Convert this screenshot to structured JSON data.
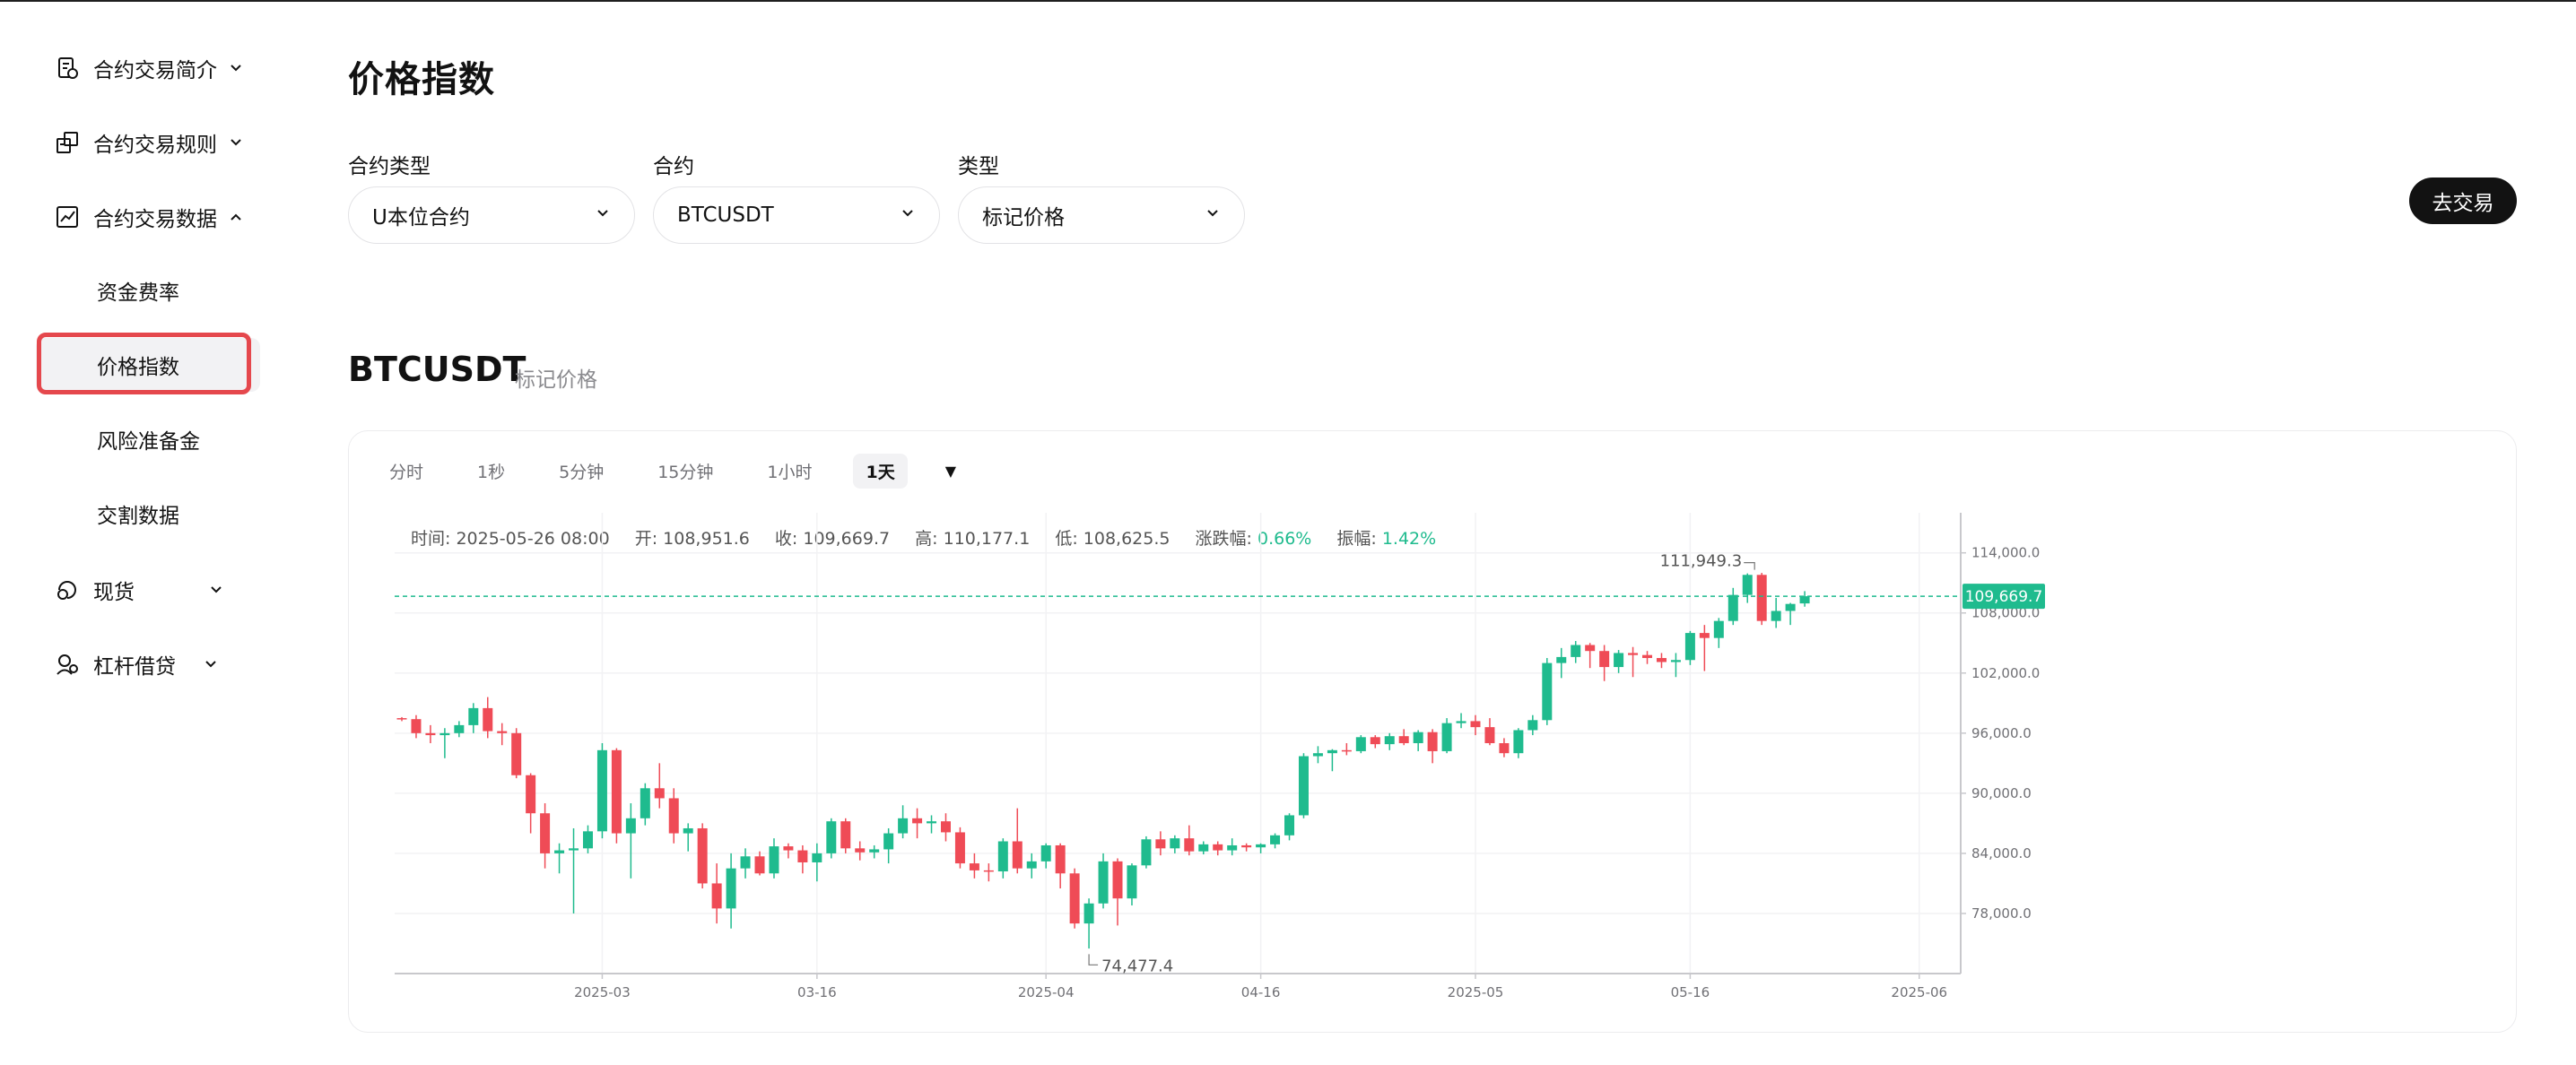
{
  "sidebar": {
    "items": [
      {
        "label": "合约交易简介",
        "icon": "document-icon",
        "expanded": false
      },
      {
        "label": "合约交易规则",
        "icon": "rules-icon",
        "expanded": false
      },
      {
        "label": "合约交易数据",
        "icon": "chart-data-icon",
        "expanded": true
      },
      {
        "label": "现货",
        "icon": "spot-icon",
        "expanded": false
      },
      {
        "label": "杠杆借贷",
        "icon": "margin-icon",
        "expanded": false
      }
    ],
    "sub_items": [
      "资金费率",
      "价格指数",
      "风险准备金",
      "交割数据"
    ],
    "active_sub": "价格指数"
  },
  "main": {
    "title": "价格指数",
    "filters": [
      {
        "label": "合约类型",
        "value": "U本位合约"
      },
      {
        "label": "合约",
        "value": "BTCUSDT"
      },
      {
        "label": "类型",
        "value": "标记价格"
      }
    ],
    "trade_button": "去交易",
    "symbol": "BTCUSDT",
    "symbol_sub": "标记价格"
  },
  "chart_toolbar": {
    "intervals": [
      "分时",
      "1秒",
      "5分钟",
      "15分钟",
      "1小时",
      "1天"
    ],
    "active": "1天",
    "more_icon": "caret-down-icon"
  },
  "ohlc_info": {
    "time_label": "时间:",
    "time": "2025-05-26 08:00",
    "open_label": "开:",
    "open": "108,951.6",
    "close_label": "收:",
    "close": "109,669.7",
    "high_label": "高:",
    "high": "110,177.1",
    "low_label": "低:",
    "low": "108,625.5",
    "change_label": "涨跌幅:",
    "change": "0.66%",
    "amplitude_label": "振幅:",
    "amplitude": "1.42%"
  },
  "colors": {
    "up": "#1fbb8e",
    "down": "#ef4b56",
    "highlight": "#e5484d"
  },
  "chart_data": {
    "type": "candlestick",
    "y_ticks": [
      "114,000.0",
      "108,000.0",
      "102,000.0",
      "96,000.0",
      "90,000.0",
      "84,000.0",
      "78,000.0"
    ],
    "ylim": [
      72000,
      118000
    ],
    "x_ticks": [
      "2025-03",
      "03-16",
      "2025-04",
      "04-16",
      "2025-05",
      "05-16",
      "2025-06"
    ],
    "start_date": "2025-02-15",
    "current_price": 109669.7,
    "current_price_label": "109,669.7",
    "max_label": "111,949.3",
    "min_label": "74,477.4",
    "max_value": 111949.3,
    "min_value": 74477.4,
    "candles": [
      [
        97500,
        97600,
        97200,
        97400
      ],
      [
        97400,
        97800,
        95500,
        96000
      ],
      [
        96000,
        96800,
        95000,
        95800
      ],
      [
        95800,
        96500,
        93500,
        96000
      ],
      [
        96000,
        97200,
        95600,
        96800
      ],
      [
        96800,
        99000,
        96000,
        98500
      ],
      [
        98500,
        99600,
        95500,
        96200
      ],
      [
        96200,
        97000,
        94800,
        96000
      ],
      [
        96000,
        96500,
        91500,
        91800
      ],
      [
        91800,
        92000,
        86000,
        88000
      ],
      [
        88000,
        89000,
        82500,
        84000
      ],
      [
        84000,
        85000,
        82000,
        84300
      ],
      [
        84300,
        86500,
        78000,
        84500
      ],
      [
        84500,
        86800,
        84000,
        86200
      ],
      [
        86200,
        95000,
        85500,
        94300
      ],
      [
        94300,
        94500,
        85000,
        86000
      ],
      [
        86000,
        89000,
        81500,
        87500
      ],
      [
        87500,
        91000,
        86800,
        90500
      ],
      [
        90500,
        93000,
        88500,
        89500
      ],
      [
        89500,
        90500,
        85000,
        86000
      ],
      [
        86000,
        87000,
        84200,
        86500
      ],
      [
        86500,
        87000,
        80500,
        81000
      ],
      [
        81000,
        83000,
        77000,
        78500
      ],
      [
        78500,
        84000,
        76500,
        82500
      ],
      [
        82500,
        84500,
        81500,
        83700
      ],
      [
        83700,
        84200,
        81800,
        82000
      ],
      [
        82000,
        85500,
        81500,
        84700
      ],
      [
        84700,
        85000,
        83500,
        84300
      ],
      [
        84300,
        84800,
        82000,
        83100
      ],
      [
        83100,
        85000,
        81200,
        84000
      ],
      [
        84000,
        87500,
        83500,
        87200
      ],
      [
        87200,
        87500,
        84000,
        84500
      ],
      [
        84500,
        85200,
        83300,
        84100
      ],
      [
        84100,
        84800,
        83500,
        84400
      ],
      [
        84400,
        86500,
        83000,
        86000
      ],
      [
        86000,
        88800,
        85500,
        87500
      ],
      [
        87500,
        88500,
        85500,
        87000
      ],
      [
        87000,
        87800,
        86000,
        87200
      ],
      [
        87200,
        88000,
        85200,
        86100
      ],
      [
        86100,
        86600,
        82500,
        83000
      ],
      [
        83000,
        84000,
        81500,
        82300
      ],
      [
        82300,
        83000,
        81200,
        82200
      ],
      [
        82200,
        85500,
        81500,
        85200
      ],
      [
        85200,
        88500,
        82000,
        82500
      ],
      [
        82500,
        84000,
        81500,
        83200
      ],
      [
        83200,
        85000,
        82500,
        84800
      ],
      [
        84800,
        85000,
        80500,
        82000
      ],
      [
        82000,
        82500,
        76500,
        77000
      ],
      [
        77000,
        79500,
        74500,
        79000
      ],
      [
        79000,
        84000,
        78500,
        83200
      ],
      [
        83200,
        83500,
        76800,
        79500
      ],
      [
        79500,
        83000,
        78800,
        82800
      ],
      [
        82800,
        85700,
        82500,
        85400
      ],
      [
        85400,
        86200,
        83800,
        84500
      ],
      [
        84500,
        85800,
        84000,
        85500
      ],
      [
        85500,
        86800,
        83800,
        84200
      ],
      [
        84200,
        85200,
        83900,
        84900
      ],
      [
        84900,
        85200,
        83800,
        84300
      ],
      [
        84300,
        85500,
        83800,
        84800
      ],
      [
        84800,
        85000,
        84200,
        84600
      ],
      [
        84600,
        85000,
        84000,
        84900
      ],
      [
        84900,
        86000,
        84500,
        85800
      ],
      [
        85800,
        88000,
        85300,
        87800
      ],
      [
        87800,
        94000,
        87500,
        93700
      ],
      [
        93700,
        94700,
        93000,
        94000
      ],
      [
        94000,
        94400,
        92200,
        94300
      ],
      [
        94300,
        95000,
        93800,
        94200
      ],
      [
        94200,
        95800,
        94000,
        95600
      ],
      [
        95600,
        95800,
        94500,
        94900
      ],
      [
        94900,
        96000,
        94300,
        95700
      ],
      [
        95700,
        96400,
        94800,
        95000
      ],
      [
        95000,
        96300,
        94200,
        96100
      ],
      [
        96100,
        96400,
        93000,
        94200
      ],
      [
        94200,
        97500,
        94000,
        97000
      ],
      [
        97000,
        98000,
        96500,
        97200
      ],
      [
        97200,
        97800,
        95800,
        96600
      ],
      [
        96600,
        97500,
        94800,
        95000
      ],
      [
        95000,
        95500,
        93600,
        94000
      ],
      [
        94000,
        96500,
        93500,
        96300
      ],
      [
        96300,
        97800,
        95800,
        97300
      ],
      [
        97300,
        103500,
        96800,
        103000
      ],
      [
        103000,
        104500,
        101500,
        103600
      ],
      [
        103600,
        105200,
        103000,
        104800
      ],
      [
        104800,
        105000,
        102500,
        104200
      ],
      [
        104200,
        104800,
        101200,
        102600
      ],
      [
        102600,
        104300,
        102000,
        104000
      ],
      [
        104000,
        104600,
        101600,
        103800
      ],
      [
        103800,
        104200,
        102900,
        103500
      ],
      [
        103500,
        104000,
        102500,
        103100
      ],
      [
        103100,
        104000,
        101600,
        103300
      ],
      [
        103300,
        106200,
        102800,
        106000
      ],
      [
        106000,
        106800,
        102200,
        105500
      ],
      [
        105500,
        107500,
        104500,
        107200
      ],
      [
        107200,
        110500,
        106800,
        109800
      ],
      [
        109800,
        111949.3,
        109000,
        111800
      ],
      [
        111800,
        112000,
        106800,
        107200
      ],
      [
        107200,
        109500,
        106500,
        108200
      ],
      [
        108200,
        109000,
        106800,
        108900
      ],
      [
        108951.6,
        110177.1,
        108625.5,
        109669.7
      ]
    ]
  }
}
